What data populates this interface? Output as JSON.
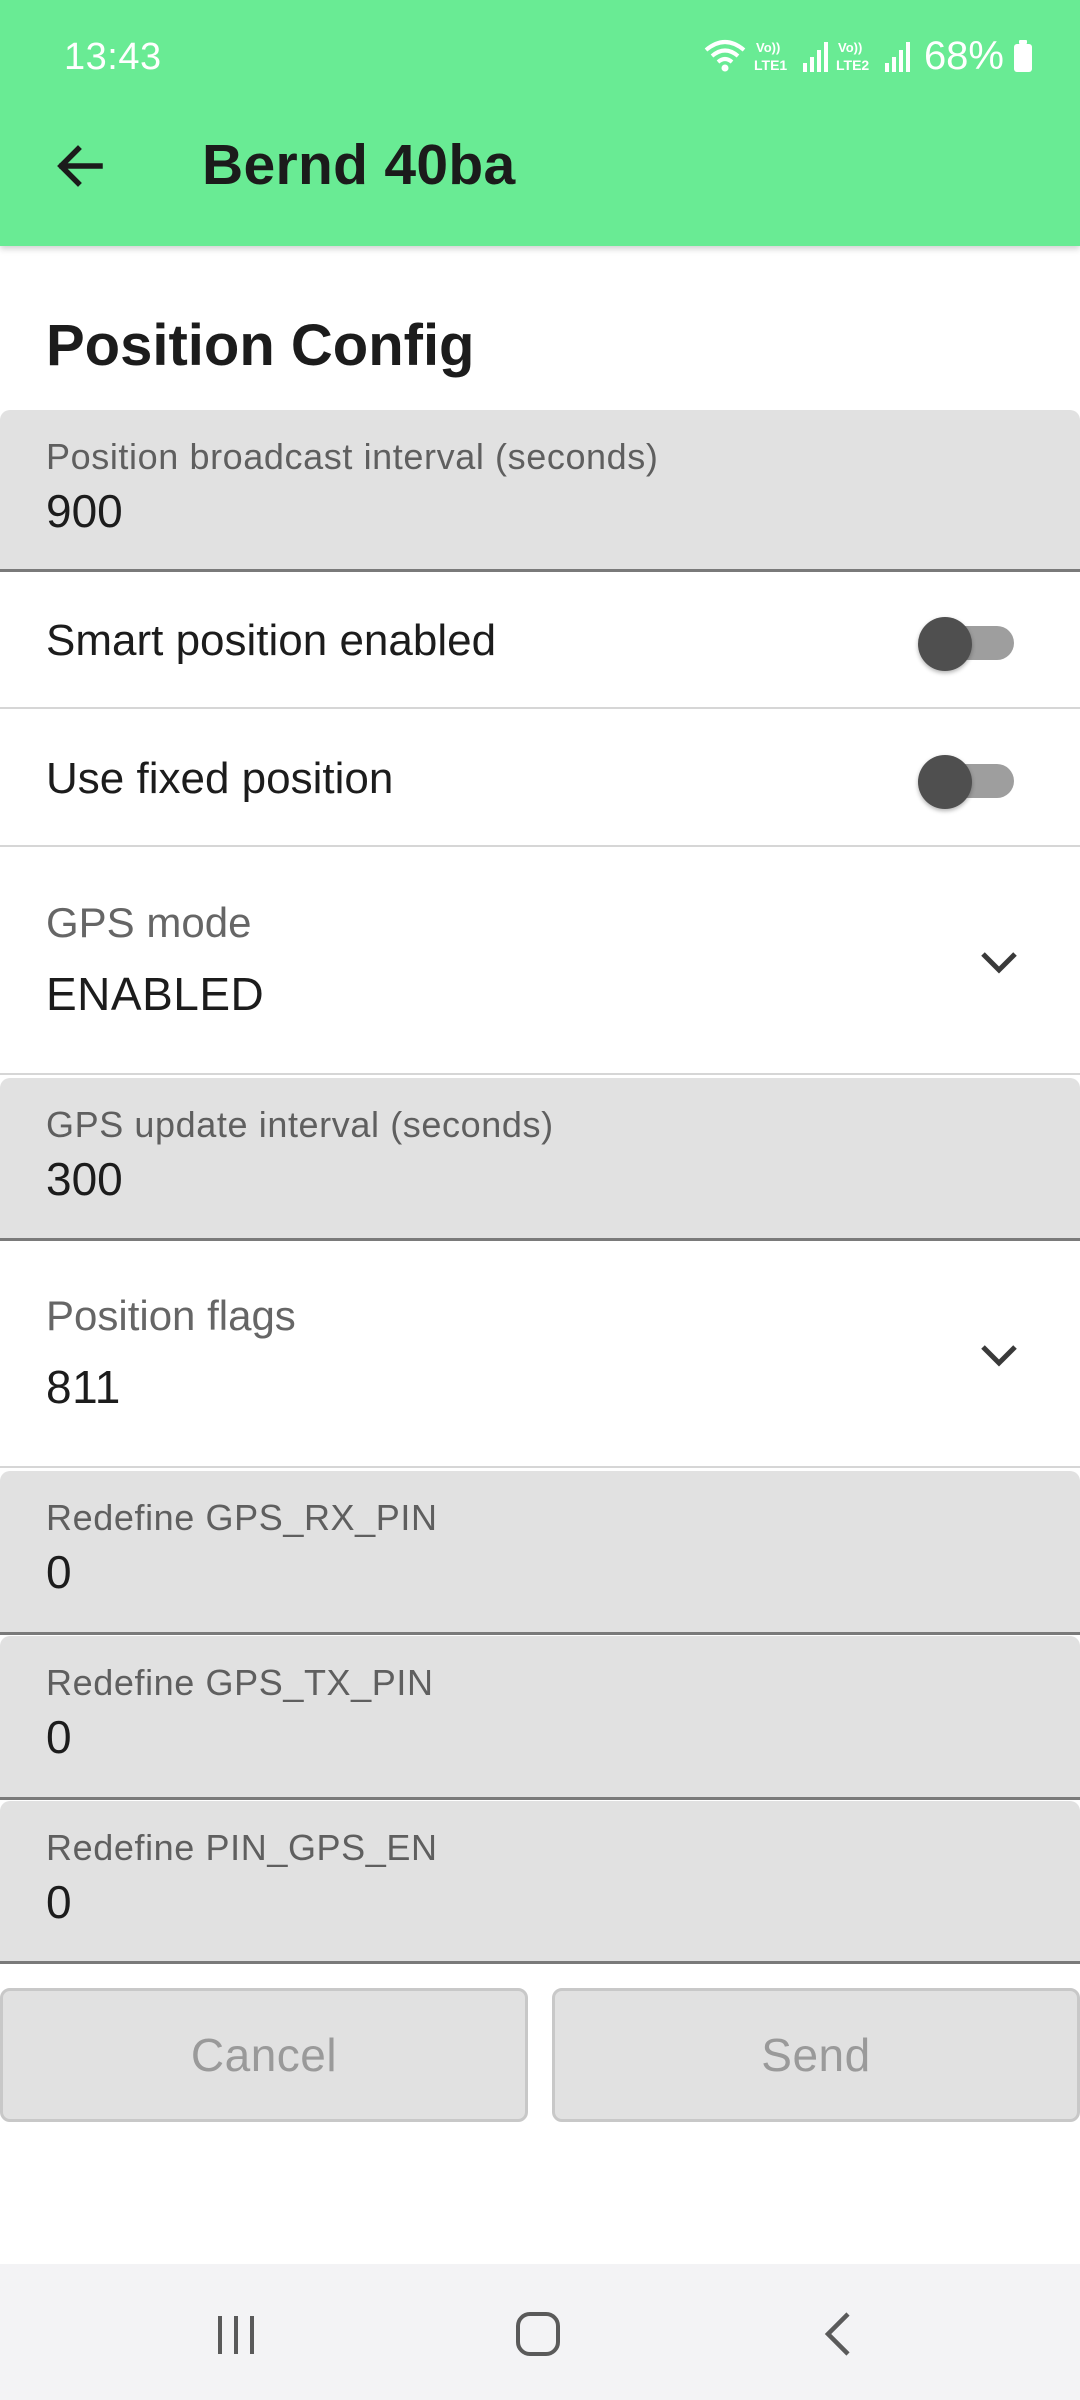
{
  "status_bar": {
    "time": "13:43",
    "battery": "68%",
    "icons": [
      "wifi-icon",
      "volte-lte1-icon",
      "signal-icon",
      "volte-lte2-icon",
      "signal-icon",
      "battery-icon"
    ]
  },
  "app_bar": {
    "title": "Bernd 40ba",
    "back_icon": "arrow-back-icon",
    "background_color": "#69eb94"
  },
  "section_title": "Position Config",
  "fields": {
    "broadcast_interval": {
      "label": "Position broadcast interval (seconds)",
      "value": "900"
    },
    "smart_position": {
      "label": "Smart position enabled",
      "checked": false
    },
    "fixed_position": {
      "label": "Use fixed position",
      "checked": false
    },
    "gps_mode": {
      "label": "GPS mode",
      "value": "ENABLED"
    },
    "gps_update_interval": {
      "label": "GPS update interval (seconds)",
      "value": "300"
    },
    "position_flags": {
      "label": "Position flags",
      "value": "811"
    },
    "gps_rx_pin": {
      "label": "Redefine GPS_RX_PIN",
      "value": "0"
    },
    "gps_tx_pin": {
      "label": "Redefine GPS_TX_PIN",
      "value": "0"
    },
    "pin_gps_en": {
      "label": "Redefine PIN_GPS_EN",
      "value": "0"
    }
  },
  "actions": {
    "cancel": "Cancel",
    "send": "Send"
  },
  "nav_bar": {
    "icons": [
      "recent-apps-icon",
      "home-icon",
      "nav-back-icon"
    ]
  }
}
